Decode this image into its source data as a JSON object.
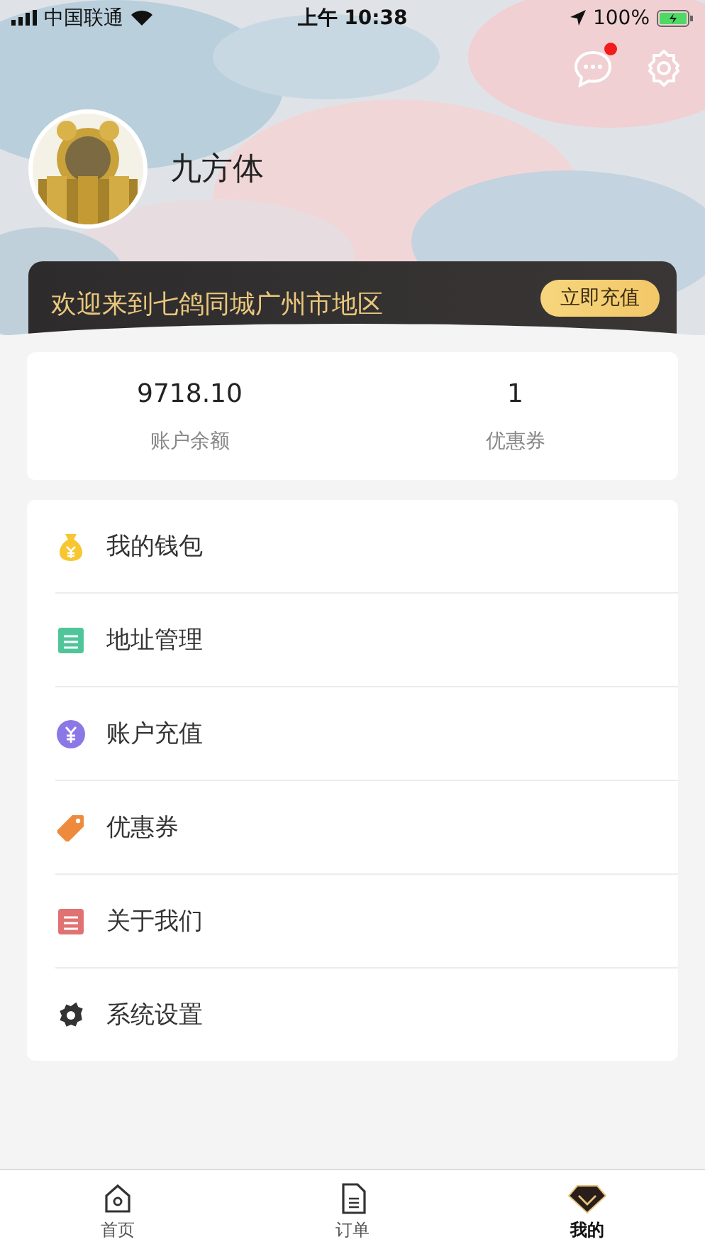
{
  "status_bar": {
    "carrier": "中国联通",
    "time": "上午 10:38",
    "battery": "100%"
  },
  "header": {
    "messages_unread": true,
    "user_name": "九方体"
  },
  "banner": {
    "text": "欢迎来到七鸽同城广州市地区",
    "button": "立即充值"
  },
  "stats": [
    {
      "value": "9718.10",
      "label": "账户余额"
    },
    {
      "value": "1",
      "label": "优惠券"
    }
  ],
  "menu": [
    {
      "kind": "wallet",
      "label": "我的钱包"
    },
    {
      "kind": "address",
      "label": "地址管理"
    },
    {
      "kind": "recharge",
      "label": "账户充值"
    },
    {
      "kind": "coupon",
      "label": "优惠券"
    },
    {
      "kind": "about",
      "label": "关于我们"
    },
    {
      "kind": "settings",
      "label": "系统设置"
    }
  ],
  "tab_bar": [
    {
      "kind": "home",
      "label": "首页",
      "selected": false
    },
    {
      "kind": "orders",
      "label": "订单",
      "selected": false
    },
    {
      "kind": "mine",
      "label": "我的",
      "selected": true
    }
  ]
}
